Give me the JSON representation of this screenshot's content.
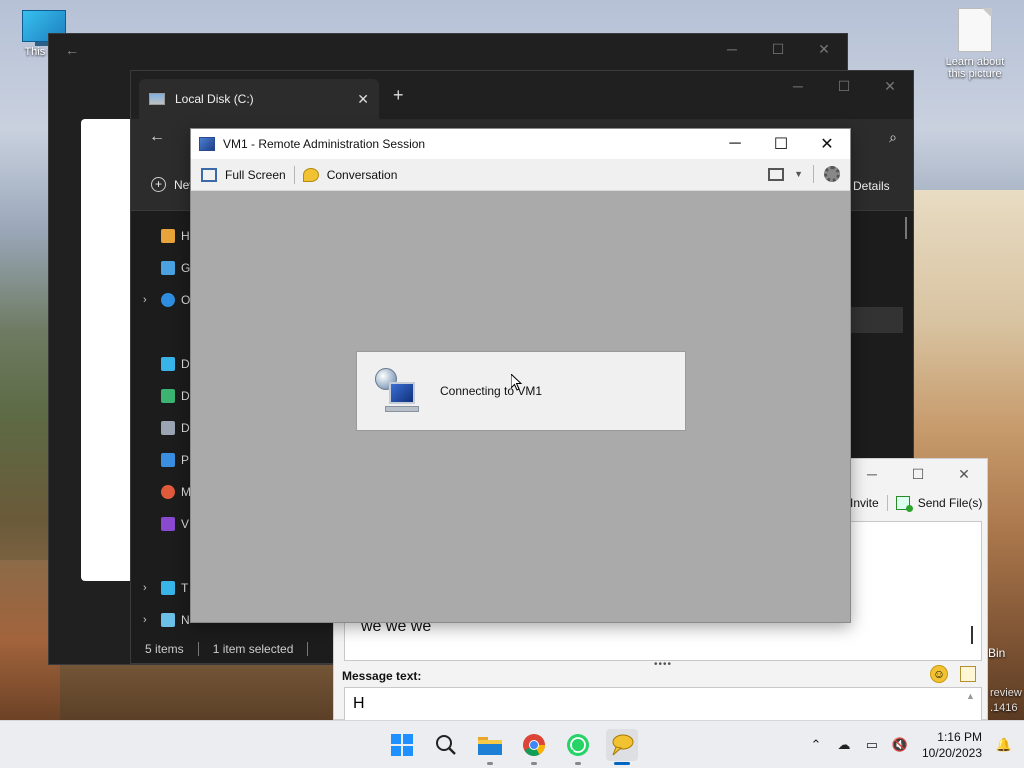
{
  "desktop": {
    "icon_this_pc_label": "This PC",
    "icon_learn_label": "Learn about this picture",
    "recycle_bin_label": "Bin",
    "watermark_line1": "review",
    "watermark_line2": ".1416"
  },
  "explorer": {
    "tab_label": "Local Disk (C:)",
    "new_label": "New",
    "details_label": "Details",
    "sidebar_letters": [
      "H",
      "G",
      "O",
      "D",
      "D",
      "D",
      "P",
      "M",
      "V",
      "T",
      "N"
    ],
    "status_items": "5 items",
    "status_selected": "1 item selected"
  },
  "vm_window": {
    "title": "VM1 - Remote Administration Session",
    "full_screen_label": "Full Screen",
    "conversation_label": "Conversation",
    "connecting_text": "Connecting to VM1"
  },
  "chat": {
    "invite_label": "Invite",
    "send_files_label": "Send File(s)",
    "history_text": "we we we",
    "message_label": "Message text:",
    "message_value": "H"
  },
  "taskbar": {
    "apps": [
      "start",
      "search",
      "file-explorer",
      "chrome",
      "whatsapp",
      "chat-app"
    ],
    "time": "1:16 PM",
    "date": "10/20/2023"
  }
}
